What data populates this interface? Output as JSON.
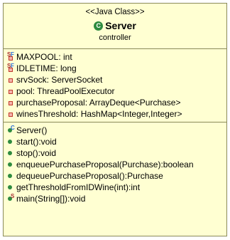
{
  "header": {
    "stereotype": "<<Java Class>>",
    "class_icon_letter": "C",
    "class_name": "Server",
    "package": "controller"
  },
  "fields": [
    {
      "text": "MAXPOOL: int",
      "visibility": "private",
      "modifiers": [
        "S",
        "F"
      ]
    },
    {
      "text": "IDLETIME: long",
      "visibility": "private",
      "modifiers": [
        "S",
        "F"
      ]
    },
    {
      "text": "srvSock: ServerSocket",
      "visibility": "private",
      "modifiers": []
    },
    {
      "text": "pool: ThreadPoolExecutor",
      "visibility": "private",
      "modifiers": []
    },
    {
      "text": "purchaseProposal: ArrayDeque<Purchase>",
      "visibility": "private",
      "modifiers": []
    },
    {
      "text": "winesThreshold: HashMap<Integer,Integer>",
      "visibility": "private",
      "modifiers": []
    }
  ],
  "methods": [
    {
      "text": "Server()",
      "visibility": "public",
      "modifiers": [
        "C"
      ]
    },
    {
      "text": "start():void",
      "visibility": "public",
      "modifiers": []
    },
    {
      "text": "stop():void",
      "visibility": "public",
      "modifiers": []
    },
    {
      "text": "enqueuePurchaseProposal(Purchase):boolean",
      "visibility": "public",
      "modifiers": []
    },
    {
      "text": "dequeuePurchaseProposal():Purchase",
      "visibility": "public",
      "modifiers": []
    },
    {
      "text": "getThresholdFromIDWine(int):int",
      "visibility": "public",
      "modifiers": []
    },
    {
      "text": "main(String[]):void",
      "visibility": "public",
      "modifiers": [
        "S"
      ]
    }
  ],
  "colors": {
    "box_fill": "#ffffd2",
    "border": "#8a8a5a",
    "public_icon": "#2e8b3f",
    "private_icon": "#c0392b"
  }
}
